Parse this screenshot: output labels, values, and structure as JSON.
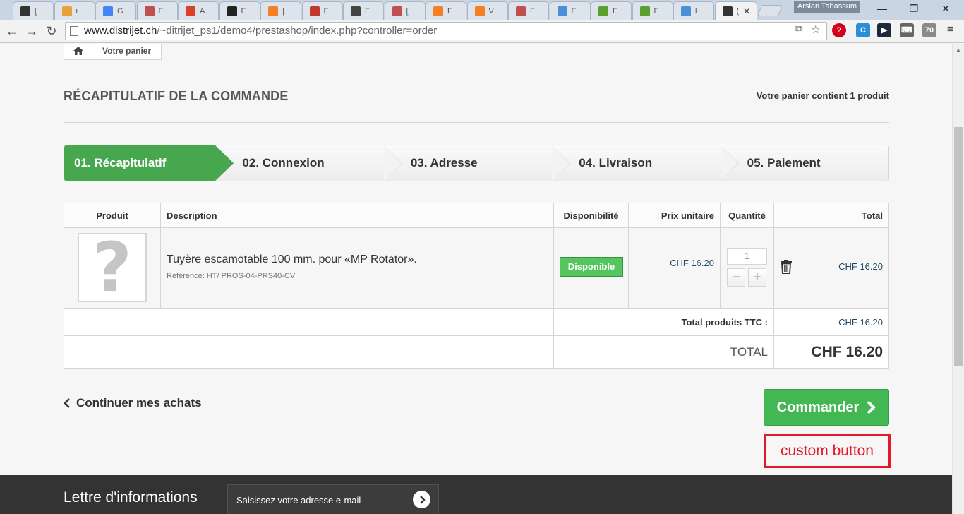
{
  "browser": {
    "tabs": [
      {
        "label": "[",
        "color": "#333333"
      },
      {
        "label": "i",
        "color": "#e8a23a"
      },
      {
        "label": "G",
        "color": "#4285f4"
      },
      {
        "label": "F",
        "color": "#c0504d"
      },
      {
        "label": "A",
        "color": "#d9412b"
      },
      {
        "label": "F",
        "color": "#222222"
      },
      {
        "label": "|",
        "color": "#f48024"
      },
      {
        "label": "F",
        "color": "#c0392b"
      },
      {
        "label": "F",
        "color": "#444444"
      },
      {
        "label": "[",
        "color": "#c0504d"
      },
      {
        "label": "F",
        "color": "#f48024"
      },
      {
        "label": "V",
        "color": "#f48024"
      },
      {
        "label": "F",
        "color": "#c0504d"
      },
      {
        "label": "F",
        "color": "#4a90d9"
      },
      {
        "label": "F",
        "color": "#5aa02c"
      },
      {
        "label": "F",
        "color": "#5aa02c"
      },
      {
        "label": "l",
        "color": "#4a90d9"
      },
      {
        "label": "(",
        "color": "#333333"
      }
    ],
    "active_tab_close": "✕",
    "profile_name": "Arslan Tabassum",
    "url_host": "www.distrijet.ch",
    "url_path": "/~ditrijet_ps1/demo4/prestashop/index.php?controller=order",
    "extensions": [
      {
        "label": "?",
        "color": "#d0021b"
      },
      {
        "label": "C",
        "color": "#2a8fd6"
      },
      {
        "label": "▶",
        "color": "#1e2a3a"
      },
      {
        "label": "⌨",
        "color": "#666666"
      },
      {
        "label": "70",
        "color": "#8a8a8a"
      }
    ]
  },
  "breadcrumb": {
    "current": "Votre panier"
  },
  "heading": {
    "title": "RÉCAPITULATIF DE LA COMMANDE",
    "cart_count": "Votre panier contient 1 produit"
  },
  "steps": [
    {
      "label": "01. Récapitulatif",
      "active": true
    },
    {
      "label": "02. Connexion",
      "active": false
    },
    {
      "label": "03. Adresse",
      "active": false
    },
    {
      "label": "04. Livraison",
      "active": false
    },
    {
      "label": "05. Paiement",
      "active": false
    }
  ],
  "cart": {
    "columns": [
      "Produit",
      "Description",
      "Disponibilité",
      "Prix unitaire",
      "Quantité",
      "",
      "Total"
    ],
    "items": [
      {
        "image_placeholder": "?",
        "name": "Tuyère escamotable 100 mm. pour «MP Rotator».",
        "reference": "Référence: HT/ PROS-04-PRS40-CV",
        "availability": "Disponible",
        "unit_price": "CHF 16.20",
        "quantity": "1",
        "total": "CHF 16.20"
      }
    ],
    "totals": {
      "products_label": "Total produits TTC :",
      "products_value": "CHF 16.20",
      "total_label": "TOTAL",
      "total_value": "CHF 16.20"
    }
  },
  "actions": {
    "continue_label": "Continuer mes achats",
    "checkout_label": "Commander",
    "custom_label": "custom button"
  },
  "footer": {
    "newsletter_title": "Lettre d'informations",
    "newsletter_placeholder": "Saisissez votre adresse e-mail"
  }
}
